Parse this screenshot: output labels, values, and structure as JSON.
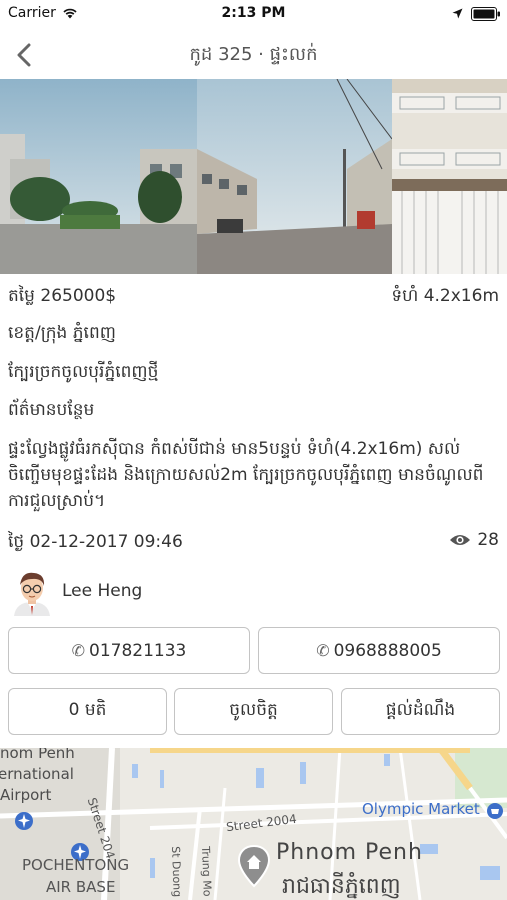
{
  "status_bar": {
    "carrier": "Carrier",
    "time": "2:13 PM"
  },
  "nav": {
    "title": "កូដ 325 · ផ្ទះលក់"
  },
  "listing": {
    "price": "តម្លៃ 265000$",
    "size": "ទំហំ 4.2x16m",
    "province": "ខេត្ត/ក្រុង ភ្នំពេញ",
    "address": "ក្បែរច្រកចូលបុរីភ្នំពេញថ្មី",
    "more_info_heading": "ព័ត៌មានបន្ថែម",
    "description": "ផ្ទះល្វែងផ្លូវធំរកស៊ីបាន កំពស់បីជាន់ មាន5បន្ទប់ ទំហំ(4.2x16m) សល់ចិញ្ចើមមុខផ្ទះដែង និងក្រោយសល់2m ក្បែរច្រកចូលបុរីភ្នំពេញ មានចំណូលពីការជួលស្រាប់។",
    "date": "ថ្ងៃ 02-12-2017 09:46",
    "views": "28"
  },
  "author": {
    "name": "Lee Heng"
  },
  "buttons": {
    "phone_1": "017821133",
    "phone_2": "0968888005",
    "like": "0 មតិ",
    "favorite": "ចូលចិត្ត",
    "report": "ផ្ដល់ដំណឹង"
  },
  "icons": {
    "phone": "✆"
  },
  "map": {
    "label_1": "nom Penh",
    "label_2": "ernational",
    "label_3": "Airport",
    "olympic": "Olympic Market",
    "street_2004": "Street 2004",
    "street_204": "Street 204",
    "trung": "Trung Mo",
    "duong": "St Duong",
    "pochentong": "POCHENTONG",
    "airbase": "AIR BASE",
    "city": "Phnom Penh",
    "city_kh": "រាជធានីភ្នំពេញ"
  },
  "colors": {
    "map_water": "#a9c7f0",
    "map_land": "#eceae4",
    "map_road": "#ffffff",
    "map_poi": "#3c6ec9"
  }
}
